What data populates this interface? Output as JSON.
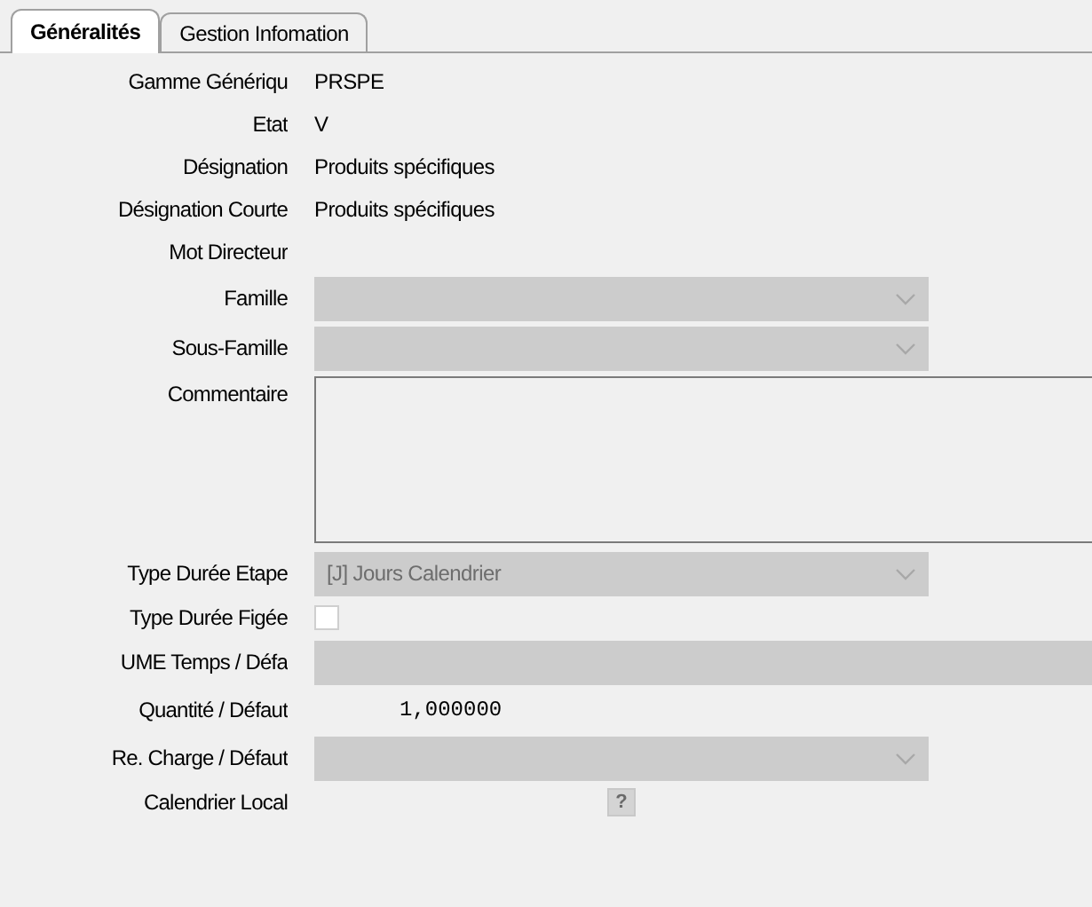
{
  "tabs": [
    {
      "label": "Généralités",
      "selected": true
    },
    {
      "label": "Gestion Infomation",
      "selected": false
    }
  ],
  "fields": [
    {
      "kind": "text",
      "label": "Gamme Génériqu",
      "value": "PRSPE"
    },
    {
      "kind": "text",
      "label": "Etat",
      "value": "V"
    },
    {
      "kind": "text",
      "label": "Désignation",
      "value": "Produits spécifiques"
    },
    {
      "kind": "text",
      "label": "Désignation Courte",
      "value": "Produits spécifiques"
    },
    {
      "kind": "text",
      "label": "Mot Directeur"
    },
    {
      "kind": "combo",
      "label": "Famille",
      "disabled": true
    },
    {
      "kind": "combo",
      "label": "Sous-Famille",
      "disabled": true
    },
    {
      "kind": "textarea",
      "label": "Commentaire"
    },
    {
      "kind": "combo",
      "label": "Type Durée Etape",
      "value": "[J] Jours Calendrier",
      "disabled": true
    },
    {
      "kind": "checkbox",
      "label": "Type Durée Figée",
      "checked": false
    },
    {
      "kind": "field",
      "label": "UME Temps / Défa",
      "disabled": true
    },
    {
      "kind": "numeric",
      "label": "Quantité / Défaut",
      "value": "1,000000"
    },
    {
      "kind": "combo",
      "label": "Re. Charge / Défaut",
      "disabled": true
    },
    {
      "kind": "help",
      "label": "Calendrier Local",
      "value": "?"
    }
  ]
}
